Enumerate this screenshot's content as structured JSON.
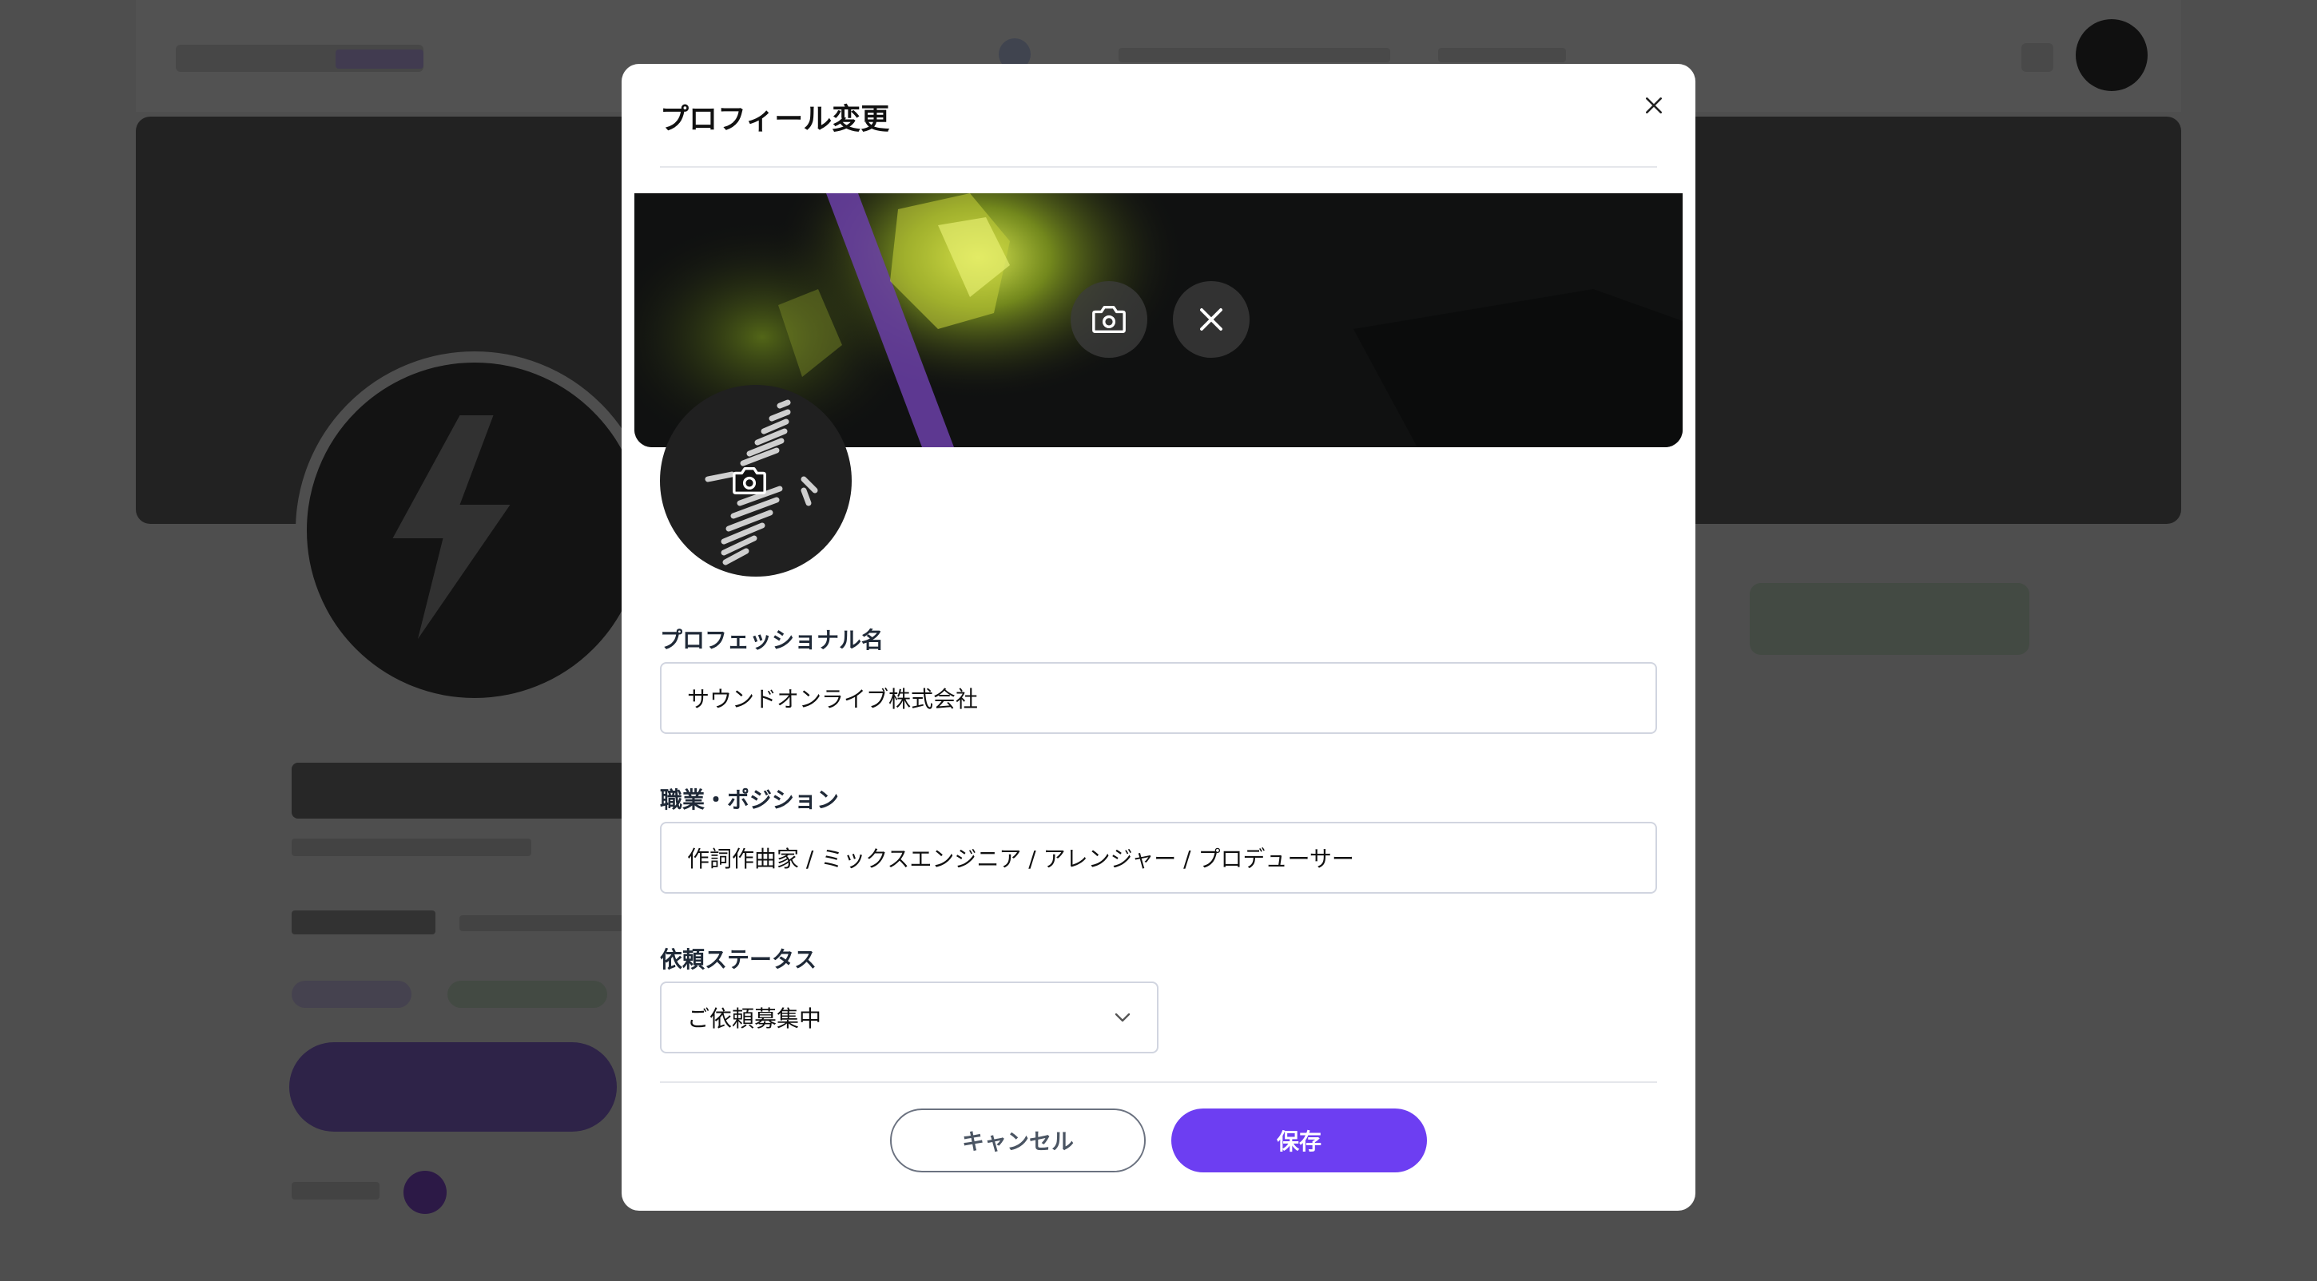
{
  "modal": {
    "title": "プロフィール変更"
  },
  "form": {
    "name_label": "プロフェッショナル名",
    "name_value": "サウンドオンライブ株式会社",
    "position_label": "職業・ポジション",
    "position_value": "作詞作曲家 / ミックスエンジニア / アレンジャー / プロデューサー",
    "status_label": "依頼ステータス",
    "status_value": "ご依頼募集中"
  },
  "actions": {
    "cancel_label": "キャンセル",
    "save_label": "保存"
  },
  "colors": {
    "accent": "#6d3ef2",
    "overlay": "rgba(0,0,0,0.68)"
  },
  "icons": [
    "close-icon",
    "camera-icon",
    "chevron-down-icon"
  ]
}
